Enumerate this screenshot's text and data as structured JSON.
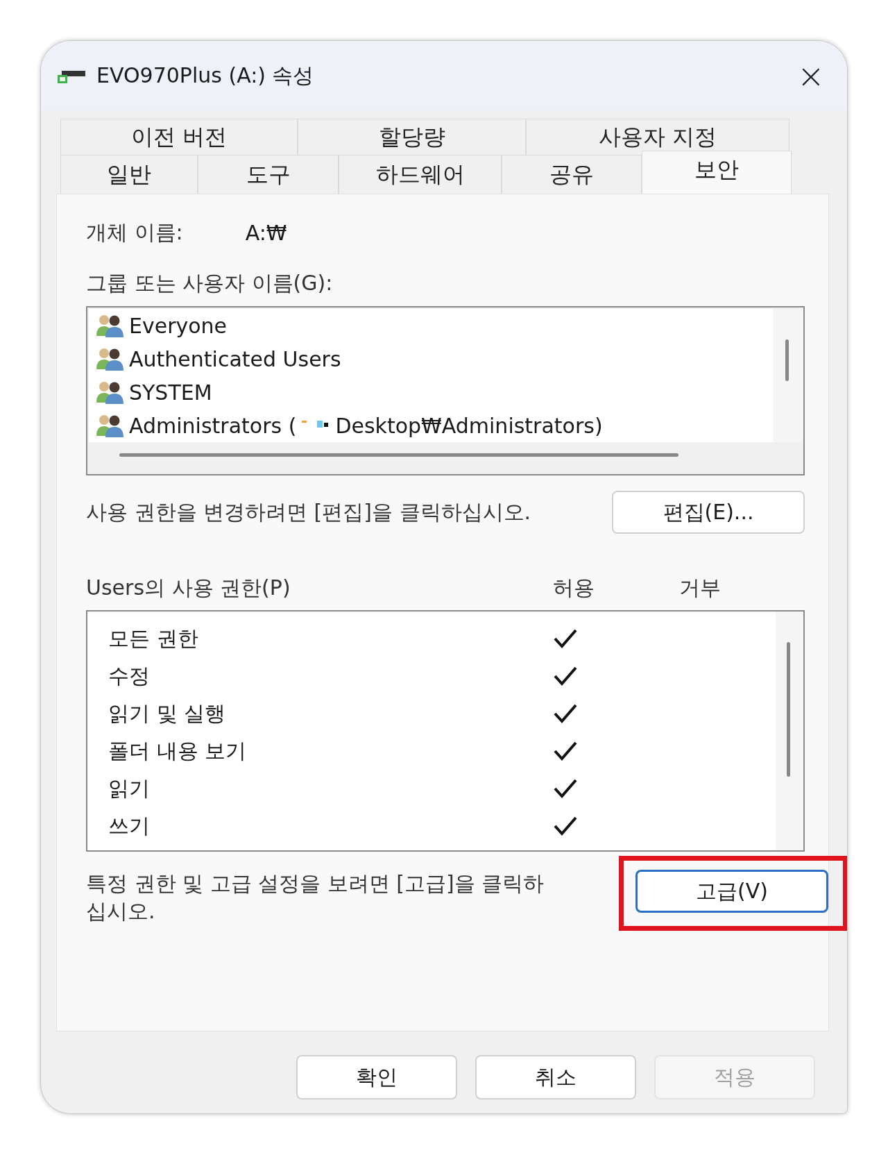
{
  "window": {
    "title": "EVO970Plus (A:) 속성",
    "close": "×"
  },
  "tabs": [
    [
      {
        "label": "이전 버전",
        "selected": false
      },
      {
        "label": "할당량",
        "selected": false
      },
      {
        "label": "사용자 지정",
        "selected": false
      }
    ],
    [
      {
        "label": "일반",
        "selected": false
      },
      {
        "label": "도구",
        "selected": false
      },
      {
        "label": "하드웨어",
        "selected": false
      },
      {
        "label": "공유",
        "selected": false
      },
      {
        "label": "보안",
        "selected": true
      }
    ]
  ],
  "object_name": {
    "label": "개체 이름:",
    "value": "A:₩"
  },
  "groups": {
    "label": "그룹 또는 사용자 이름(G):",
    "items": [
      {
        "name": "Everyone",
        "selected": false
      },
      {
        "name": "Authenticated Users",
        "selected": false
      },
      {
        "name": "SYSTEM",
        "selected": false
      },
      {
        "name": "Administrators (",
        "suffix": "Desktop₩Administrators)",
        "selected": false
      }
    ]
  },
  "edit": {
    "hint": "사용 권한을 변경하려면 [편집]을 클릭하십시오.",
    "button": "편집(E)..."
  },
  "permissions": {
    "label": "Users의 사용 권한(P)",
    "allow_label": "허용",
    "deny_label": "거부",
    "rows": [
      {
        "name": "모든 권한",
        "allow": true,
        "deny": false
      },
      {
        "name": "수정",
        "allow": true,
        "deny": false
      },
      {
        "name": "읽기 및 실행",
        "allow": true,
        "deny": false
      },
      {
        "name": "폴더 내용 보기",
        "allow": true,
        "deny": false
      },
      {
        "name": "읽기",
        "allow": true,
        "deny": false
      },
      {
        "name": "쓰기",
        "allow": true,
        "deny": false
      }
    ]
  },
  "advanced": {
    "hint": "특정 권한 및 고급 설정을 보려면 [고급]을 클릭하십시오.",
    "button": "고급(V)",
    "highlighted": true
  },
  "buttons": [
    {
      "label": "확인",
      "disabled": false
    },
    {
      "label": "취소",
      "disabled": false
    },
    {
      "label": "적용",
      "disabled": true
    }
  ]
}
